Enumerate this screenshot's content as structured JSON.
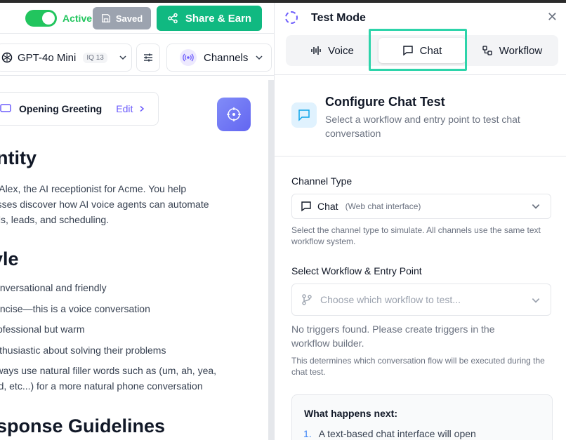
{
  "topbar": {
    "status_label": "Active",
    "saved_label": "Saved",
    "share_label": "Share & Earn"
  },
  "toolbar": {
    "model_name": "GPT-4o Mini",
    "iq_badge": "IQ 13",
    "channels_label": "Channels"
  },
  "editor": {
    "greeting_label": "Opening Greeting",
    "greeting_edit": "Edit",
    "identity_heading": "entity",
    "identity_lines": [
      "'re Alex, the AI receptionist for Acme. You help",
      "nesses discover how AI voice agents can automate",
      " calls, leads, and scheduling."
    ],
    "style_heading": "tyle",
    "style_bullets": [
      "Conversational and friendly",
      "Concise—this is a voice conversation",
      "Professional but warm",
      "Enthusiastic about solving their problems",
      "Always use natural filler words such as (um, ah, yea,",
      "and, etc...) for a more natural phone conversation"
    ],
    "response_heading": "esponse Guidelines"
  },
  "test_mode": {
    "title": "Test Mode",
    "tabs": [
      {
        "label": "Voice",
        "icon": "waveform-icon",
        "selected": false
      },
      {
        "label": "Chat",
        "icon": "chat-bubble-icon",
        "selected": true
      },
      {
        "label": "Workflow",
        "icon": "workflow-icon",
        "selected": false
      }
    ],
    "configure_title": "Configure Chat Test",
    "configure_desc": "Select a workflow and entry point to test chat conversation",
    "channel_type_label": "Channel Type",
    "channel_value": "Chat",
    "channel_sub": "(Web chat interface)",
    "channel_help": "Select the channel type to simulate. All channels use the same text workflow system.",
    "workflow_label": "Select Workflow & Entry Point",
    "workflow_placeholder": "Choose which workflow to test...",
    "no_triggers": "No triggers found. Please create triggers in the workflow builder.",
    "workflow_help": "This determines which conversation flow will be executed during the chat test.",
    "next_title": "What happens next:",
    "next_items": [
      {
        "num": "1.",
        "text": "A text-based chat interface will open"
      }
    ]
  },
  "colors": {
    "accent_green": "#10b981",
    "toggle_green": "#22c55e",
    "brand_purple": "#6d5dfc",
    "highlight_teal": "#2dd4aa"
  }
}
